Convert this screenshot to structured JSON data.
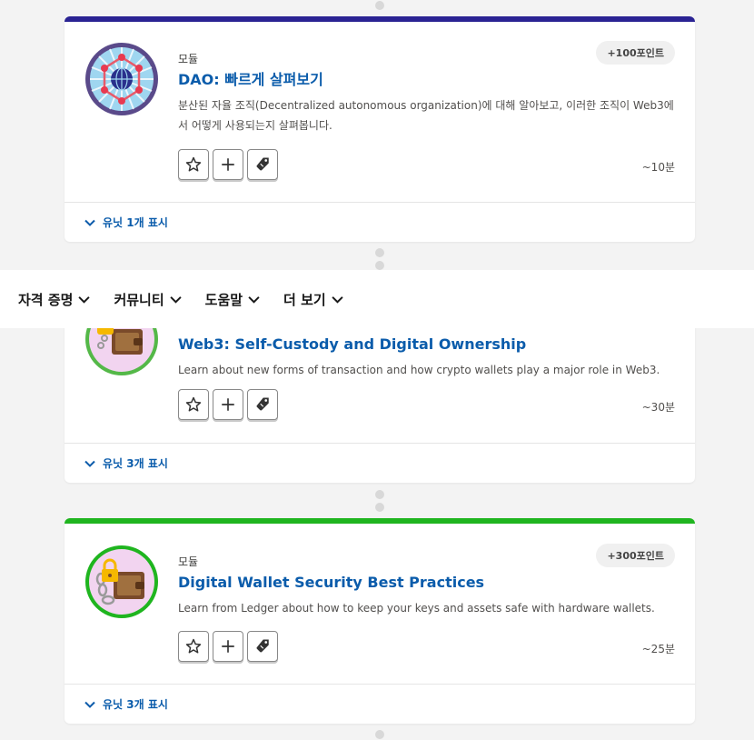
{
  "navbar": {
    "items": [
      {
        "label": "자격 증명"
      },
      {
        "label": "커뮤니티"
      },
      {
        "label": "도움말"
      },
      {
        "label": "더 보기"
      }
    ]
  },
  "cards": [
    {
      "type_label": "모듈",
      "title": "DAO: 빠르게 살펴보기",
      "description": "분산된 자율 조직(Decentralized autonomous organization)에 대해 알아보고, 이러한 조직이 Web3에서 어떻게 사용되는지 살펴봅니다.",
      "points": "+100포인트",
      "duration": "~10분",
      "units": "유닛 1개 표시",
      "accent": "#2a2393"
    },
    {
      "title": "Web3: Self-Custody and Digital Ownership",
      "description": "Learn about new forms of transaction and how crypto wallets play a major role in Web3.",
      "duration": "~30분",
      "units": "유닛 3개 표시",
      "accent": "#4cba3c"
    },
    {
      "type_label": "모듈",
      "title": "Digital Wallet Security Best Practices",
      "description": "Learn from Ledger about how to keep your keys and assets safe with hardware wallets.",
      "points": "+300포인트",
      "duration": "~25분",
      "units": "유닛 3개 표시",
      "accent": "#1fb51f"
    }
  ],
  "icons": {
    "favorite": "star-icon",
    "add": "plus-icon",
    "tag": "tag-icon",
    "expand": "chevron-down-icon"
  }
}
